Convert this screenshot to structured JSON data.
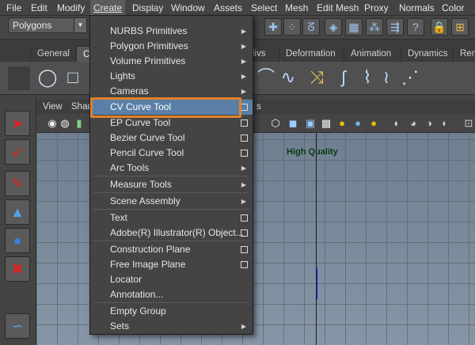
{
  "menubar": {
    "items": [
      "File",
      "Edit",
      "Modify",
      "Create",
      "Display",
      "Window",
      "Assets",
      "Select",
      "Mesh",
      "Edit Mesh",
      "Proxy",
      "Normals",
      "Color"
    ]
  },
  "shelfbar": {
    "mode": "Polygons"
  },
  "tabs": [
    "General",
    "C",
    "divs",
    "Deformation",
    "Animation",
    "Dynamics",
    "Ren"
  ],
  "viewport": {
    "menu": [
      "View",
      "Shad",
      "s"
    ],
    "quality_label": "High Quality"
  },
  "create_menu": {
    "items": [
      {
        "label": "NURBS Primitives",
        "submenu": true
      },
      {
        "label": "Polygon Primitives",
        "submenu": true
      },
      {
        "label": "Volume Primitives",
        "submenu": true
      },
      {
        "label": "Lights",
        "submenu": true
      },
      {
        "label": "Cameras",
        "submenu": true
      },
      {
        "label": "CV Curve Tool",
        "options": true,
        "highlighted": true
      },
      {
        "label": "EP Curve Tool",
        "options": true
      },
      {
        "label": "Bezier Curve Tool",
        "options": true
      },
      {
        "label": "Pencil Curve Tool",
        "options": true
      },
      {
        "label": "Arc Tools",
        "submenu": true
      },
      {
        "label": "Measure Tools",
        "submenu": true
      },
      {
        "label": "Scene Assembly",
        "submenu": true
      },
      {
        "label": "Text",
        "options": true
      },
      {
        "label": "Adobe(R) Illustrator(R) Object...",
        "options": true
      },
      {
        "label": "Construction Plane",
        "options": true
      },
      {
        "label": "Free Image Plane",
        "options": true
      },
      {
        "label": "Locator"
      },
      {
        "label": "Annotation..."
      },
      {
        "label": "Empty Group"
      },
      {
        "label": "Sets",
        "submenu": true
      }
    ]
  },
  "colors": {
    "highlight": "#5a7fa8",
    "callout": "#e0812a",
    "quality_text": "#0a3a12"
  }
}
